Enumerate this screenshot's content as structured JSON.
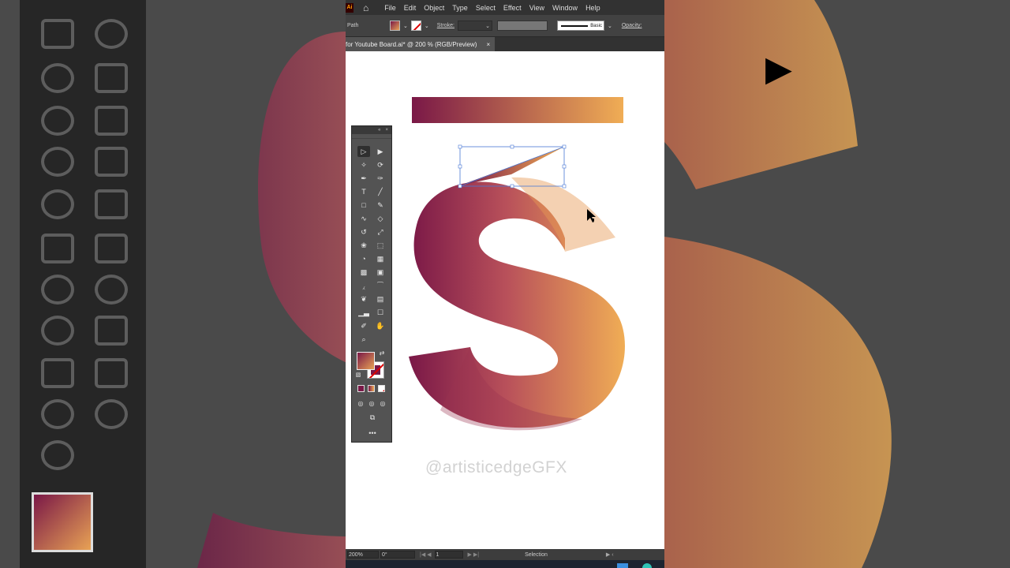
{
  "menu": {
    "logo": "Ai",
    "items": [
      "File",
      "Edit",
      "Object",
      "Type",
      "Select",
      "Effect",
      "View",
      "Window",
      "Help"
    ]
  },
  "control_bar": {
    "selection_type": "Path",
    "stroke_label": "Stroke:",
    "brush_label": "Basic",
    "opacity_label": "Opacity:"
  },
  "document_tab": {
    "title": "for Youtube Board.ai* @ 200 % (RGB/Preview)",
    "close": "×"
  },
  "status_bar": {
    "zoom": "200%",
    "rotation": "0°",
    "artboard": "1",
    "mode": "Selection"
  },
  "watermark": "@artisticedgeGFX",
  "icons": {
    "home": "home-icon",
    "cursor": "cursor-icon",
    "tools": [
      "selection-tool-icon",
      "direct-selection-tool-icon",
      "magic-wand-icon",
      "lasso-icon",
      "pen-tool-icon",
      "curvature-tool-icon",
      "type-tool-icon",
      "line-tool-icon",
      "rectangle-tool-icon",
      "paintbrush-icon",
      "shaper-tool-icon",
      "eraser-icon",
      "rotate-tool-icon",
      "scale-tool-icon",
      "width-tool-icon",
      "free-transform-icon",
      "shape-builder-icon",
      "perspective-grid-icon",
      "mesh-tool-icon",
      "gradient-tool-icon",
      "eyedropper-icon",
      "blend-tool-icon",
      "symbol-sprayer-icon",
      "column-graph-icon",
      "artboard-tool-icon",
      "slice-tool-icon",
      "hand-tool-icon",
      "zoom-tool-icon"
    ]
  },
  "colors": {
    "gradient_start": "#7a1847",
    "gradient_end": "#f0ad55",
    "ui_dark": "#323232",
    "ui_panel": "#535353"
  }
}
